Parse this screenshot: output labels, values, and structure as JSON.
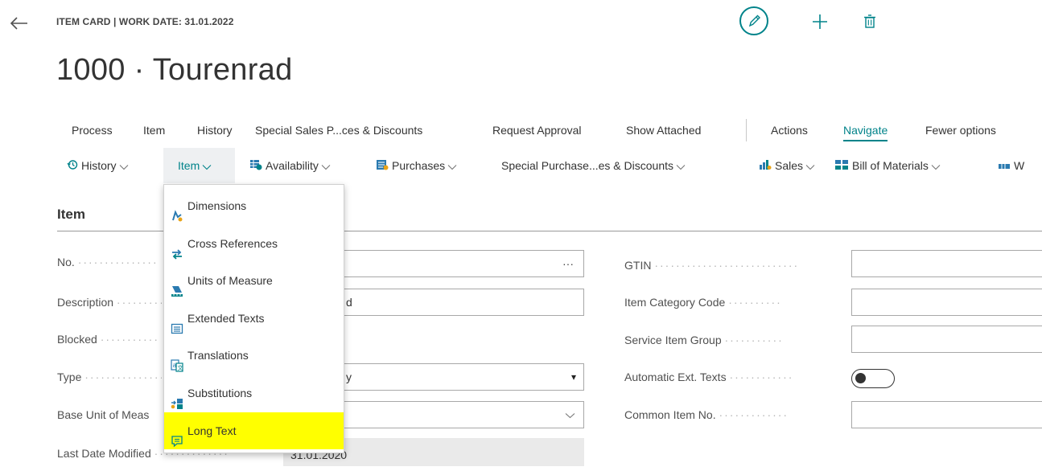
{
  "header": {
    "caption": "ITEM CARD | WORK DATE: 31.01.2022",
    "title": "1000 · Tourenrad"
  },
  "action_bar": {
    "items": [
      {
        "label": "Process"
      },
      {
        "label": "Item"
      },
      {
        "label": "History"
      },
      {
        "label": "Special Sales P...ces & Discounts"
      },
      {
        "label": "Request Approval"
      },
      {
        "label": "Show Attached"
      },
      {
        "label": "Actions"
      },
      {
        "label": "Navigate",
        "active": true
      },
      {
        "label": "Fewer options"
      }
    ]
  },
  "sub_bar": {
    "items": [
      {
        "label": "History",
        "icon": "history-icon"
      },
      {
        "label": "Item",
        "icon": ""
      },
      {
        "label": "Availability",
        "icon": "availability-icon"
      },
      {
        "label": "Purchases",
        "icon": "purchases-icon"
      },
      {
        "label": "Special Purchase...es & Discounts",
        "icon": ""
      },
      {
        "label": "Sales",
        "icon": "sales-icon"
      },
      {
        "label": "Bill of Materials",
        "icon": "bill-of-materials-icon"
      },
      {
        "label": "W",
        "icon": "warehouse-icon"
      }
    ]
  },
  "item_menu": {
    "items": [
      {
        "label": "Dimensions",
        "icon": "dimensions-icon"
      },
      {
        "label": "Cross References",
        "icon": "cross-references-icon"
      },
      {
        "label": "Units of Measure",
        "icon": "units-of-measure-icon"
      },
      {
        "label": "Extended Texts",
        "icon": "extended-texts-icon"
      },
      {
        "label": "Translations",
        "icon": "translations-icon"
      },
      {
        "label": "Substitutions",
        "icon": "substitutions-icon"
      },
      {
        "label": "Long Text",
        "icon": "long-text-icon",
        "highlighted": true
      }
    ]
  },
  "section": {
    "title": "Item"
  },
  "left_fields": [
    {
      "label": "No.",
      "value": "",
      "suffix": "···"
    },
    {
      "label": "Description",
      "value": "d"
    },
    {
      "label": "Blocked",
      "value": ""
    },
    {
      "label": "Type",
      "value": "y",
      "suffix": "▾"
    },
    {
      "label": "Base Unit of Meas",
      "value": "",
      "suffix": "chevron"
    },
    {
      "label": "Last Date Modified",
      "value": "31.01.2020"
    }
  ],
  "right_fields": [
    {
      "label": "GTIN",
      "value": ""
    },
    {
      "label": "Item Category Code",
      "value": ""
    },
    {
      "label": "Service Item Group",
      "value": ""
    },
    {
      "label": "Automatic Ext. Texts",
      "toggle": false
    },
    {
      "label": "Common Item No.",
      "value": ""
    }
  ],
  "colors": {
    "accent": "#00838a",
    "highlight": "#ffff00"
  }
}
